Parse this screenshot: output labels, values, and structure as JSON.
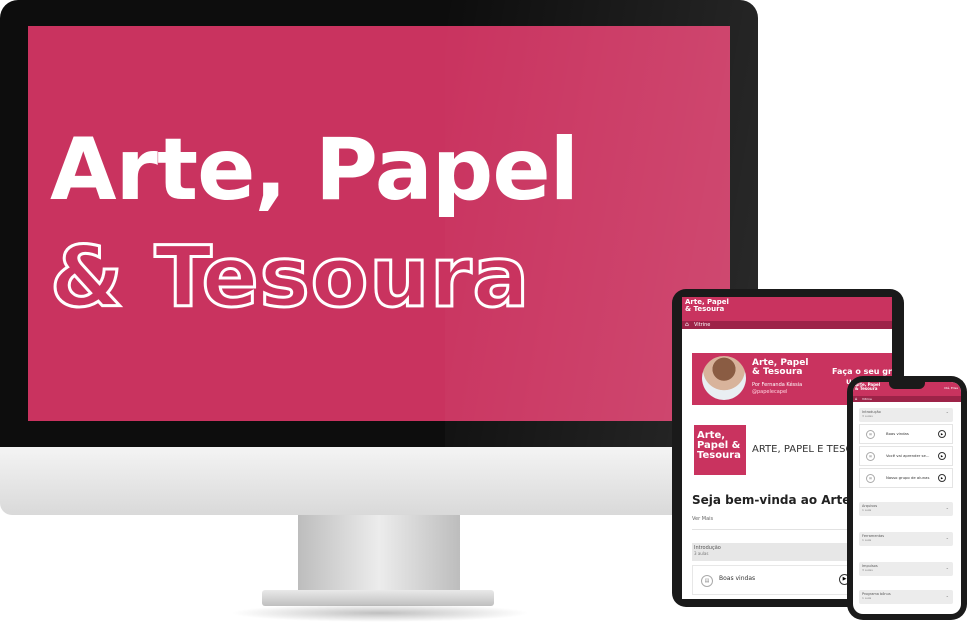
{
  "hero": {
    "line1": "Arte, Papel",
    "line2": "& Tesoura"
  },
  "tablet": {
    "logo_line1": "Arte, Papel",
    "logo_line2": "& Tesoura",
    "nav_label": "Vitrine",
    "banner": {
      "title_line1": "Arte, Papel",
      "title_line2": "& Tesoura",
      "author": "Por Fernanda Késsia",
      "handle": "@papelecapel",
      "cta_line1": "Faça o seu grón",
      "cta_line2": "us"
    },
    "course_logo": [
      "Arte,",
      "Papel &",
      "Tesoura"
    ],
    "course_name": "ARTE, PAPEL E TESO",
    "welcome": "Seja bem-vinda ao Arte, Pap",
    "see_more": "Ver Mais",
    "module": {
      "title": "Introdução",
      "subtitle": "3 aulas"
    },
    "lesson": "Boas vindas"
  },
  "phone": {
    "logo_line1": "Arte, Papel",
    "logo_line2": "& Tesoura",
    "user": "Olá, Elisa",
    "nav_label": "Vitrine",
    "intro": {
      "title": "Introdução",
      "subtitle": "3 aulas"
    },
    "lessons": [
      "Boas vindas",
      "Você vai aprender se...",
      "Nosso grupo de alunas"
    ],
    "modules": [
      {
        "title": "Arquivos",
        "subtitle": "1 aula"
      },
      {
        "title": "Ferramentas",
        "subtitle": "1 aula"
      },
      {
        "title": "Impulsos",
        "subtitle": "3 aulas"
      },
      {
        "title": "Programa bônus",
        "subtitle": "1 aula"
      }
    ]
  },
  "colors": {
    "brand": "#c9335f",
    "brand_dark": "#9d2348"
  }
}
